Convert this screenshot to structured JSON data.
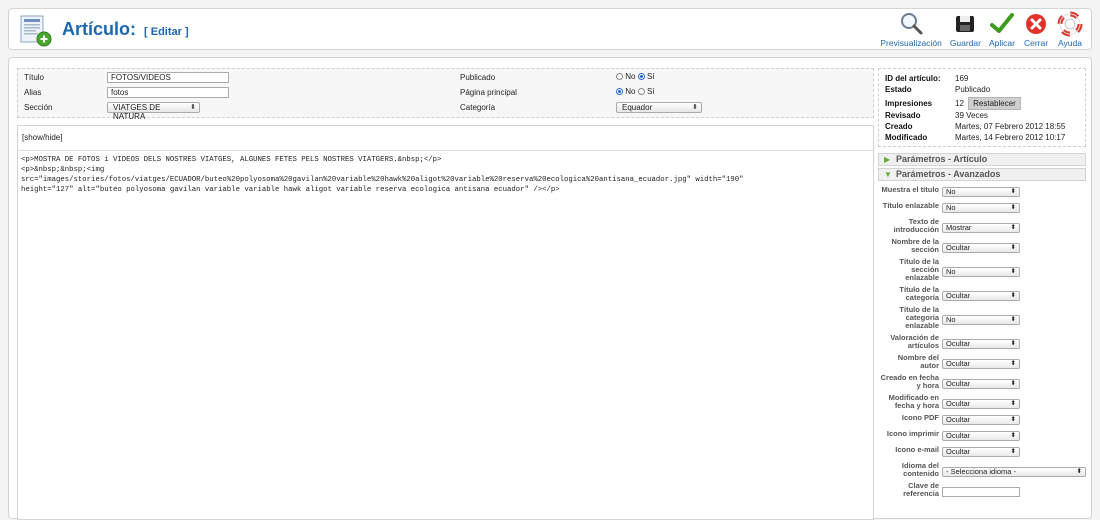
{
  "header": {
    "title": "Artículo:",
    "edit_label": "[ Editar ]",
    "toolbar": [
      {
        "label": "Previsualización",
        "icon": "preview-icon"
      },
      {
        "label": "Guardar",
        "icon": "save-icon"
      },
      {
        "label": "Aplicar",
        "icon": "apply-icon"
      },
      {
        "label": "Cerrar",
        "icon": "close-icon"
      },
      {
        "label": "Ayuda",
        "icon": "help-icon"
      }
    ]
  },
  "form": {
    "titulo_label": "Título",
    "titulo_value": "FOTOS/VIDEOS",
    "alias_label": "Alias",
    "alias_value": "fotos",
    "seccion_label": "Sección",
    "seccion_value": "VIATGES DE NATURA",
    "publicado_label": "Publicado",
    "pagina_label": "Página principal",
    "categoria_label": "Categoría",
    "categoria_value": "Equador",
    "no_label": "No",
    "si_label": "Sí",
    "publicado_selected": "Sí",
    "pagina_selected": "No"
  },
  "info": {
    "id_label": "ID del artículo:",
    "id_value": "169",
    "estado_label": "Estado",
    "estado_value": "Publicado",
    "impresiones_label": "Impresiones",
    "impresiones_value": "12",
    "reset_label": "Restablecer",
    "revisado_label": "Revisado",
    "revisado_value": "39 Veces",
    "creado_label": "Creado",
    "creado_value": "Martes, 07 Febrero 2012 18:55",
    "modificado_label": "Modificado",
    "modificado_value": "Martes, 14 Febrero 2012 10:17"
  },
  "editor": {
    "toggle_label": "[show/hide]",
    "content": "<p>MOSTRA DE FOTOS i VIDEOS DELS NOSTRES VIATGES, ALGUNES FETES PELS NOSTRES VIATGERS.&nbsp;</p>\n<p>&nbsp;&nbsp;<img\nsrc=\"images/stories/fotos/viatges/ECUADOR/buteo%20polyosoma%20gavilan%20variable%20hawk%20aligot%20variable%20reserva%20ecologica%20antisana_ecuador.jpg\" width=\"190\"\nheight=\"127\" alt=\"buteo polyosoma gavilan variable variable hawk aligot variable reserva ecologica antisana ecuador\" /></p>"
  },
  "params": {
    "articulo_header": "Parámetros - Artículo",
    "avanzados_header": "Parámetros - Avanzados",
    "rows": [
      {
        "label": "Muestra el título",
        "value": "No",
        "lines": 1
      },
      {
        "label": "Título enlazable",
        "value": "No",
        "lines": 1
      },
      {
        "label": "Texto de introducción",
        "value": "Mostrar",
        "lines": 2
      },
      {
        "label": "Nombre de la sección",
        "value": "Ocultar",
        "lines": 2
      },
      {
        "label": "Título de la sección enlazable",
        "value": "No",
        "lines": 3
      },
      {
        "label": "Título de la categoría",
        "value": "Ocultar",
        "lines": 2
      },
      {
        "label": "Título de la categoría enlazable",
        "value": "No",
        "lines": 3
      },
      {
        "label": "Valoración de artículos",
        "value": "Ocultar",
        "lines": 2
      },
      {
        "label": "Nombre del autor",
        "value": "Ocultar",
        "lines": 2
      },
      {
        "label": "Creado en fecha y hora",
        "value": "Ocultar",
        "lines": 2
      },
      {
        "label": "Modificado en fecha y hora",
        "value": "Ocultar",
        "lines": 2
      },
      {
        "label": "Icono PDF",
        "value": "Ocultar",
        "lines": 1
      },
      {
        "label": "Icono imprimir",
        "value": "Ocultar",
        "lines": 1
      },
      {
        "label": "Icono e-mail",
        "value": "Ocultar",
        "lines": 1
      },
      {
        "label": "Idioma del contenido",
        "value": "- Selecciona idioma -",
        "lines": 2
      },
      {
        "label": "Clave de referencia",
        "value": "",
        "lines": 2
      }
    ]
  }
}
